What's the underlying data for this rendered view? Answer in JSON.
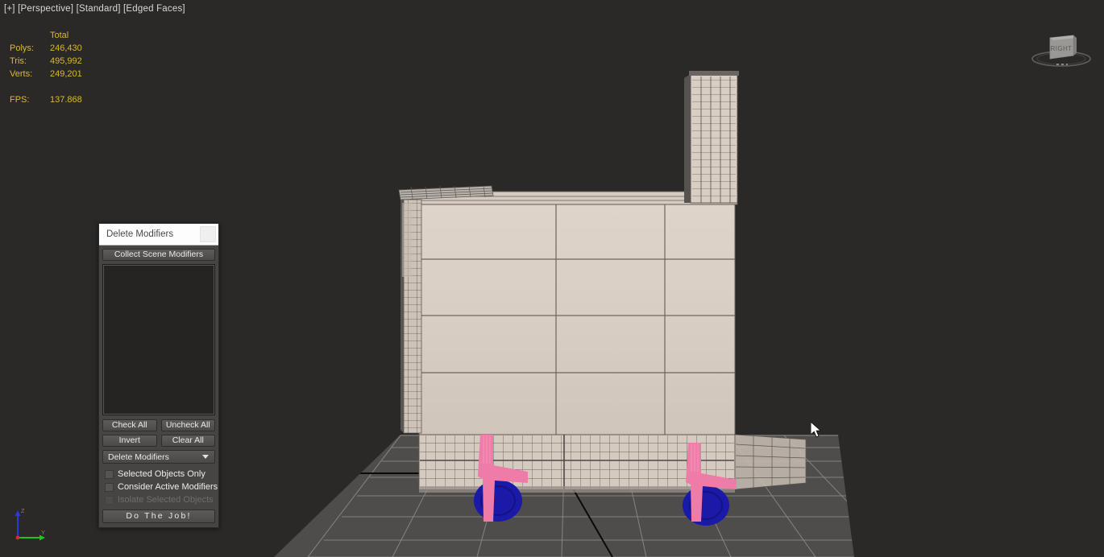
{
  "viewport": {
    "label": "[+] [Perspective] [Standard] [Edged Faces]",
    "background_color": "#2b2927",
    "grid_color": "#8d8d8d",
    "ground_color": "#4f4d4b",
    "building_color": "#d9cfc6",
    "wire_color": "#57534f",
    "figure_color": "#ef7ba8",
    "base_color": "#1a19a8",
    "cursor_icon": "arrow-cursor"
  },
  "stats": {
    "header": "Total",
    "color": "#d8b838",
    "rows": [
      {
        "label": "Polys:",
        "value": "246,430"
      },
      {
        "label": "Tris:",
        "value": "495,992"
      },
      {
        "label": "Verts:",
        "value": "249,201"
      }
    ],
    "fps": {
      "label": "FPS:",
      "value": "137.868"
    }
  },
  "viewcube": {
    "face_label": "RIGHT",
    "icon": "view-cube-icon"
  },
  "axis_tripod": {
    "z_label": "Z",
    "y_label": "Y",
    "z_color": "#2a3ad8",
    "y_color": "#1fc41f",
    "x_color": "#d82a2a"
  },
  "dialog": {
    "title": "Delete Modifiers",
    "title_button_icon": "window-menu-icon",
    "collect_button": "Collect Scene Modifiers",
    "list_items": [],
    "buttons": {
      "check_all": "Check All",
      "uncheck_all": "Uncheck All",
      "invert": "Invert",
      "clear_all": "Clear All"
    },
    "dropdown": {
      "selected": "Delete Modifiers",
      "arrow_icon": "chevron-down-icon",
      "options": [
        "Delete Modifiers"
      ]
    },
    "checkboxes": [
      {
        "label": "Selected Objects Only",
        "checked": false,
        "disabled": false
      },
      {
        "label": "Consider Active Modifiers",
        "checked": false,
        "disabled": false
      },
      {
        "label": "Isolate Selected Objects",
        "checked": false,
        "disabled": true
      }
    ],
    "action_button": "Do The Job!"
  }
}
